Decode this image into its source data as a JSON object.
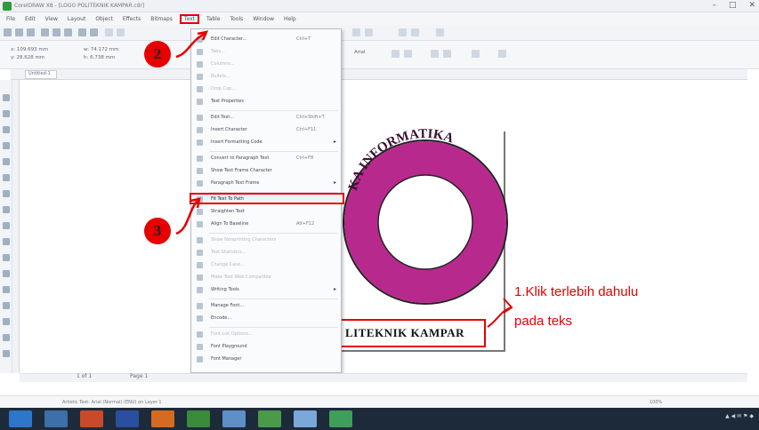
{
  "window": {
    "title": "CorelDRAW X8 - [LOGO POLITEKNIK KAMPAR.cdr]",
    "controls": [
      "–",
      "□",
      "✕"
    ]
  },
  "menubar": {
    "items": [
      "File",
      "Edit",
      "View",
      "Layout",
      "Object",
      "Effects",
      "Bitmaps",
      "Text",
      "Table",
      "Tools",
      "Window",
      "Help"
    ],
    "active_index": 7
  },
  "propertybar": {
    "x": "x: 109.693 mm",
    "y": "y: 28.628 mm",
    "w": "w: 74.172 mm",
    "h": "h: 6.738 mm",
    "font_size": "Arial",
    "zoom": "100%"
  },
  "document_tab": "Untitled-1",
  "dropdown": {
    "items": [
      {
        "label": "Edit Character...",
        "shortcut": "Ctrl+T",
        "disabled": false,
        "arrow": false
      },
      {
        "label": "Tabs...",
        "shortcut": "",
        "disabled": true,
        "arrow": false
      },
      {
        "label": "Columns...",
        "shortcut": "",
        "disabled": true,
        "arrow": false
      },
      {
        "label": "Bullets...",
        "shortcut": "",
        "disabled": true,
        "arrow": false
      },
      {
        "label": "Drop Cap...",
        "shortcut": "",
        "disabled": true,
        "arrow": false
      },
      {
        "label": "Text Properties",
        "shortcut": "",
        "disabled": false,
        "arrow": false
      },
      {
        "label": "Edit Text...",
        "shortcut": "Ctrl+Shift+T",
        "disabled": false,
        "arrow": false
      },
      {
        "label": "Insert Character",
        "shortcut": "Ctrl+F11",
        "disabled": false,
        "arrow": false
      },
      {
        "label": "Insert Formatting Code",
        "shortcut": "",
        "disabled": false,
        "arrow": true
      },
      {
        "label": "Convert to Paragraph Text",
        "shortcut": "Ctrl+F8",
        "disabled": false,
        "arrow": false
      },
      {
        "label": "Show Text Frame Character",
        "shortcut": "",
        "disabled": false,
        "arrow": false
      },
      {
        "label": "Paragraph Text Frame",
        "shortcut": "",
        "disabled": false,
        "arrow": true
      },
      {
        "label": "Fit Text To Path",
        "shortcut": "",
        "disabled": false,
        "arrow": false,
        "highlight": true
      },
      {
        "label": "Straighten Text",
        "shortcut": "",
        "disabled": false,
        "arrow": false
      },
      {
        "label": "Align To Baseline",
        "shortcut": "Alt+F12",
        "disabled": false,
        "arrow": false
      },
      {
        "label": "Show Nonprinting Characters",
        "shortcut": "",
        "disabled": true,
        "arrow": false
      },
      {
        "label": "Text Statistics...",
        "shortcut": "",
        "disabled": true,
        "arrow": false
      },
      {
        "label": "Change Case...",
        "shortcut": "",
        "disabled": true,
        "arrow": false
      },
      {
        "label": "Make Text Web Compatible",
        "shortcut": "",
        "disabled": true,
        "arrow": false
      },
      {
        "label": "Writing Tools",
        "shortcut": "",
        "disabled": false,
        "arrow": true
      },
      {
        "label": "Manage Font...",
        "shortcut": "",
        "disabled": false,
        "arrow": false
      },
      {
        "label": "Encode...",
        "shortcut": "",
        "disabled": false,
        "arrow": false
      },
      {
        "label": "Font List Options...",
        "shortcut": "",
        "disabled": true,
        "arrow": false
      },
      {
        "label": "Font Playground",
        "shortcut": "",
        "disabled": false,
        "arrow": false
      },
      {
        "label": "Font Manager",
        "shortcut": "",
        "disabled": false,
        "arrow": false
      }
    ]
  },
  "canvas": {
    "ring_text": "KA INFORMATIKA",
    "selected_text": "LITEKNIK KAMPAR"
  },
  "annotations": {
    "step1_text_line1": "1.Klik terlebih dahulu",
    "step1_text_line2": "pada teks",
    "step2_number": "2",
    "step3_number": "3"
  },
  "pagenav": {
    "label": "1 of 1",
    "page": "Page 1"
  },
  "statusbar": {
    "left": "Artistic Text: Arial (Normal) (ENU) on Layer 1",
    "right": "100%"
  },
  "colors": {
    "annotation_red": "#e60000",
    "ring_magenta": "#b8298e",
    "taskbar": "#1d2a3a"
  }
}
